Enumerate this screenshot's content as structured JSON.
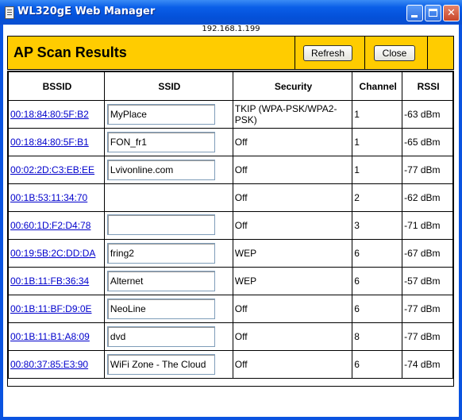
{
  "window": {
    "title": "WL320gE Web Manager",
    "address": "192.168.1.199"
  },
  "header": {
    "title": "AP Scan Results",
    "refresh_label": "Refresh",
    "close_label": "Close"
  },
  "table": {
    "columns": [
      "BSSID",
      "SSID",
      "Security",
      "Channel",
      "RSSI"
    ],
    "rows": [
      {
        "bssid": "00:18:84:80:5F:B2",
        "ssid": "MyPlace",
        "security": "TKIP (WPA-PSK/WPA2-PSK)",
        "channel": "1",
        "rssi": "-63 dBm"
      },
      {
        "bssid": "00:18:84:80:5F:B1",
        "ssid": "FON_fr1",
        "security": "Off",
        "channel": "1",
        "rssi": "-65 dBm"
      },
      {
        "bssid": "00:02:2D:C3:EB:EE",
        "ssid": "Lvivonline.com",
        "security": "Off",
        "channel": "1",
        "rssi": "-77 dBm"
      },
      {
        "bssid": "00:1B:53:11:34:70",
        "ssid": "",
        "security": "Off",
        "channel": "2",
        "rssi": "-62 dBm"
      },
      {
        "bssid": "00:60:1D:F2:D4:78",
        "ssid": "",
        "security": "Off",
        "channel": "3",
        "rssi": "-71 dBm"
      },
      {
        "bssid": "00:19:5B:2C:DD:DA",
        "ssid": "fring2",
        "security": "WEP",
        "channel": "6",
        "rssi": "-67 dBm"
      },
      {
        "bssid": "00:1B:11:FB:36:34",
        "ssid": "Alternet",
        "security": "WEP",
        "channel": "6",
        "rssi": "-57 dBm"
      },
      {
        "bssid": "00:1B:11:BF:D9:0E",
        "ssid": "NeoLine",
        "security": "Off",
        "channel": "6",
        "rssi": "-77 dBm"
      },
      {
        "bssid": "00:1B:11:B1:A8:09",
        "ssid": "dvd",
        "security": "Off",
        "channel": "8",
        "rssi": "-77 dBm"
      },
      {
        "bssid": "00:80:37:85:E3:90",
        "ssid": "WiFi Zone - The Cloud",
        "security": "Off",
        "channel": "6",
        "rssi": "-74 dBm"
      }
    ]
  },
  "colors": {
    "header_bg": "#ffcc00",
    "link": "#0000cc",
    "titlebar": "#0a5ee8"
  }
}
